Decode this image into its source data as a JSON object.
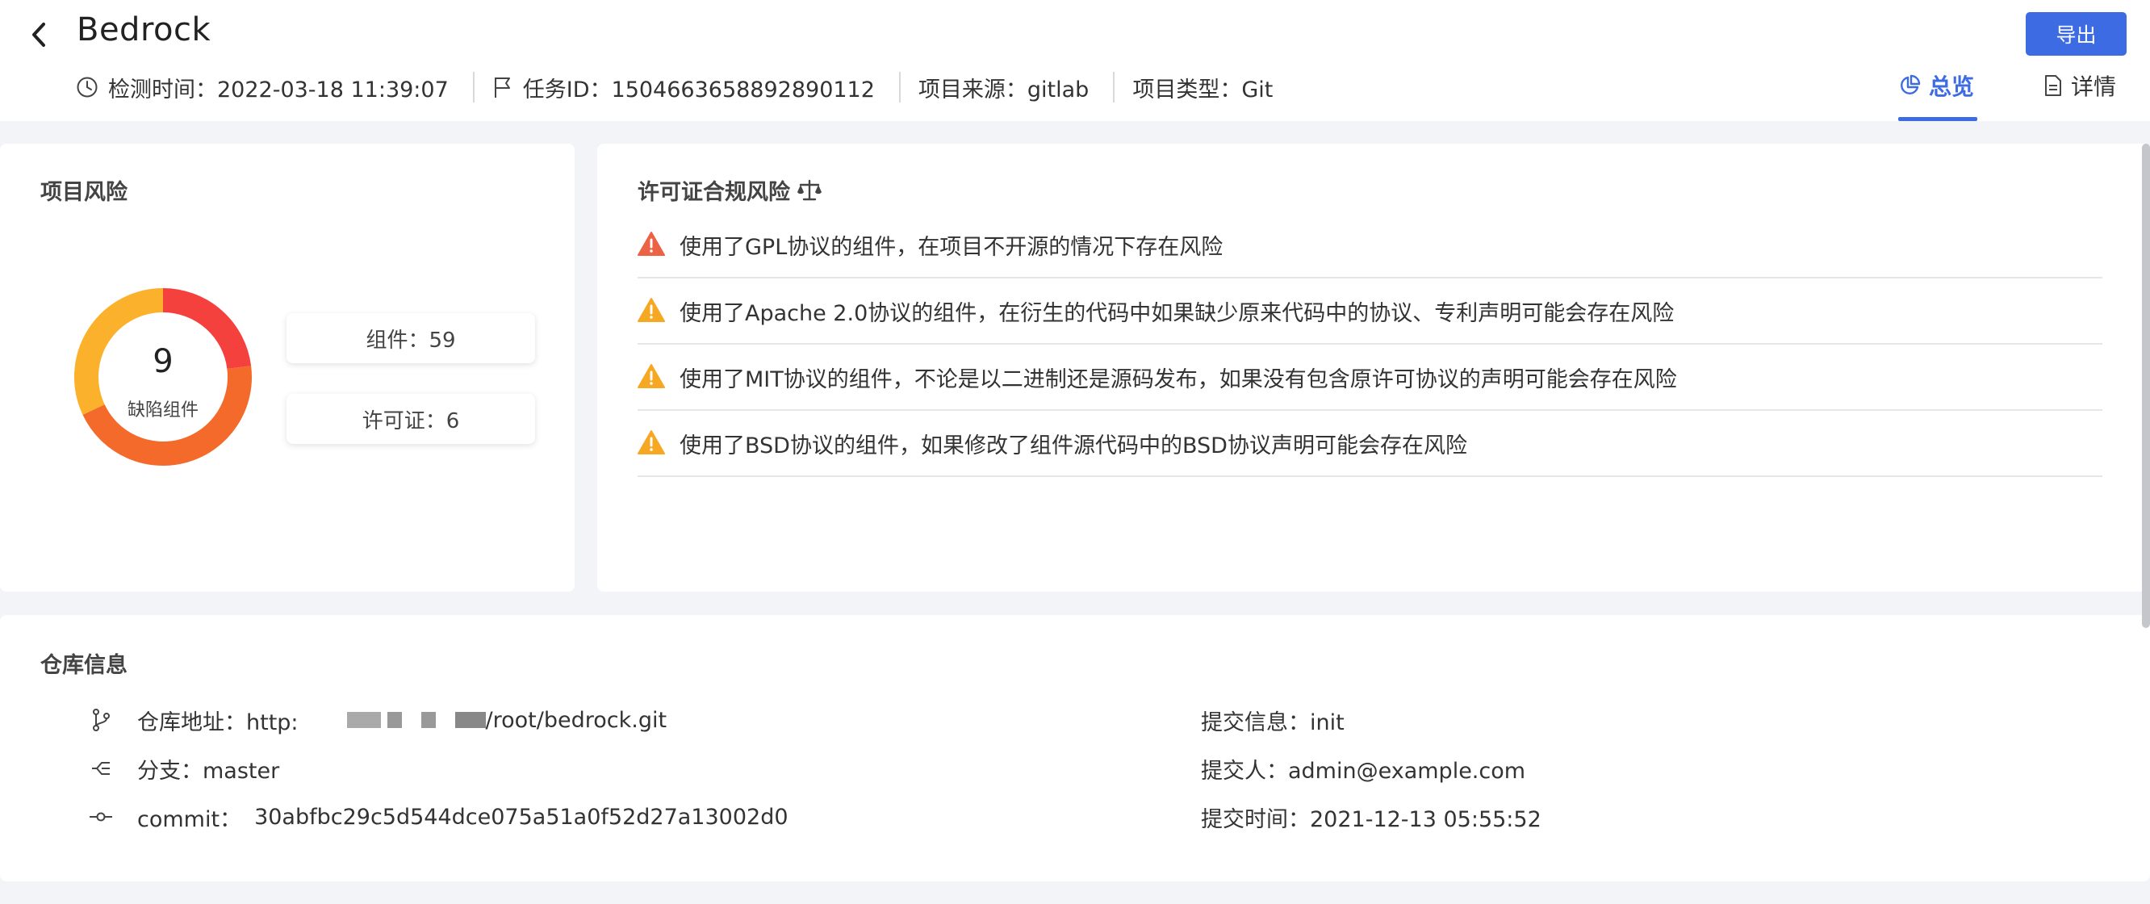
{
  "header": {
    "title": "Bedrock",
    "export_label": "导出",
    "meta": [
      {
        "icon": "clock-icon",
        "text": "检测时间：2022-03-18 11:39:07"
      },
      {
        "icon": "flag-icon",
        "text": "任务ID：1504663658892890112"
      },
      {
        "icon": "",
        "text": "项目来源：gitlab"
      },
      {
        "icon": "",
        "text": "项目类型：Git"
      }
    ],
    "tabs": [
      {
        "icon": "pie-chart-icon",
        "label": "总览",
        "active": true
      },
      {
        "icon": "document-icon",
        "label": "详情",
        "active": false
      }
    ]
  },
  "project_risk": {
    "title": "项目风险",
    "defect_count": "9",
    "defect_label": "缺陷组件",
    "components": "组件：59",
    "licenses": "许可证：6",
    "segments": [
      {
        "color": "#f5413d",
        "fraction": 0.23
      },
      {
        "color": "#f46a2b",
        "fraction": 0.45
      },
      {
        "color": "#fbb12c",
        "fraction": 0.32
      }
    ]
  },
  "license_risk": {
    "title": "许可证合规风险",
    "title_icon": "scale-icon",
    "items": [
      {
        "level": "high",
        "color": "#eb6245",
        "text": "使用了GPL协议的组件，在项目不开源的情况下存在风险"
      },
      {
        "level": "medium",
        "color": "#f7a823",
        "text": "使用了Apache 2.0协议的组件，在衍生的代码中如果缺少原来代码中的协议、专利声明可能会存在风险"
      },
      {
        "level": "medium",
        "color": "#f7a823",
        "text": "使用了MIT协议的组件，不论是以二进制还是源码发布，如果没有包含原许可协议的声明可能会存在风险"
      },
      {
        "level": "medium",
        "color": "#f7a823",
        "text": "使用了BSD协议的组件，如果修改了组件源代码中的BSD协议声明可能会存在风险"
      }
    ]
  },
  "repo": {
    "title": "仓库信息",
    "address_prefix": "仓库地址：http:",
    "address_suffix": "/root/bedrock.git",
    "branch": "分支：master",
    "commit_label": "commit：",
    "commit_value": "30abfbc29c5d544dce075a51a0f52d27a13002d0",
    "commit_msg": "提交信息：init",
    "committer": "提交人：admin@example.com",
    "commit_time": "提交时间：2021-12-13 05:55:52"
  }
}
